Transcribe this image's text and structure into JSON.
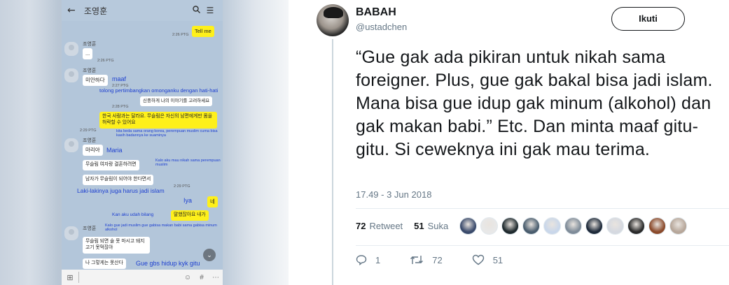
{
  "chat": {
    "contact_name": "조영훈",
    "messages": [
      {
        "id": "m1",
        "text": "Tell me",
        "time": "2:26 PTG"
      },
      {
        "id": "m2",
        "text": "...",
        "time": "2:26 PTG"
      },
      {
        "id": "m3",
        "text": "미안하다",
        "time": "2:27 PTG"
      },
      {
        "id": "m4",
        "text": "신중하게 나의 이야기를 고려하세요",
        "time": "2:28 PTG"
      },
      {
        "id": "m5",
        "text": "한국 사람과는 달라요. 무슬림은 자신의 남편에게만 몸을 허락할 수 있어요",
        "time": "2:29 PTG"
      },
      {
        "id": "m6",
        "text": "마리아",
        "time": ""
      },
      {
        "id": "m7",
        "text": "무슬림 여자랑 결혼하려면",
        "time": ""
      },
      {
        "id": "m8",
        "text": "남자가 무슬림이 되어야 한다면서",
        "time": "2:29 PTG"
      },
      {
        "id": "m9",
        "text": "네",
        "time": ""
      },
      {
        "id": "m10",
        "text": "말했잖아요 내가",
        "time": ""
      },
      {
        "id": "m11",
        "text": "무슬림 되면 술 못 마시고 돼지고기 못먹잖아",
        "time": ""
      },
      {
        "id": "m12",
        "text": "나 그렇게는 못산다",
        "time": ""
      }
    ],
    "translations": {
      "maaf": "maaf",
      "pertimbangkan": "tolong pertimbangkan omonganku dengan hati-hati",
      "kita_beda": "kita beda sama orang korea, perempuan muslim cuma bisa kasih badannya ke suaminya",
      "maria": "Maria",
      "kalo_aku": "Kalo aku mau nikah sama perempuan muslim",
      "laki": "Laki-lakinya juga harus jadi islam",
      "iya": "Iya",
      "kan_aku": "Kan aku udah bilang",
      "kalo_gue": "Kalo gue jadi muslim gue gabisa makan babi sama gabisa minum alkohol",
      "gue_gbs": "Gue gbs hidup kyk gitu"
    }
  },
  "tweet": {
    "display_name": "BABAH",
    "handle": "@ustadchen",
    "follow_label": "Ikuti",
    "text": "“Gue gak ada pikiran untuk nikah sama foreigner. Plus, gue gak bakal bisa jadi islam. Mana bisa gue idup gak minum (alkohol) dan gak makan babi.” Etc. Dan minta maaf gitu-gitu. Si ceweknya ini gak mau terima.",
    "timestamp": "17.49 - 3 Jun 2018",
    "retweet_count": "72",
    "retweet_label": "Retweet",
    "like_count": "51",
    "like_label": "Suka",
    "reply_count": "1",
    "action_retweets": "72",
    "action_likes": "51",
    "liker_colors": [
      "#3a4a6b",
      "#e8e8e8",
      "#1f2a2e",
      "#4a5d6e",
      "#c9d7ea",
      "#7f8c99",
      "#1e2a3a",
      "#d5d9e0",
      "#2a2a2a",
      "#8b4a2b",
      "#b7a79a"
    ]
  }
}
